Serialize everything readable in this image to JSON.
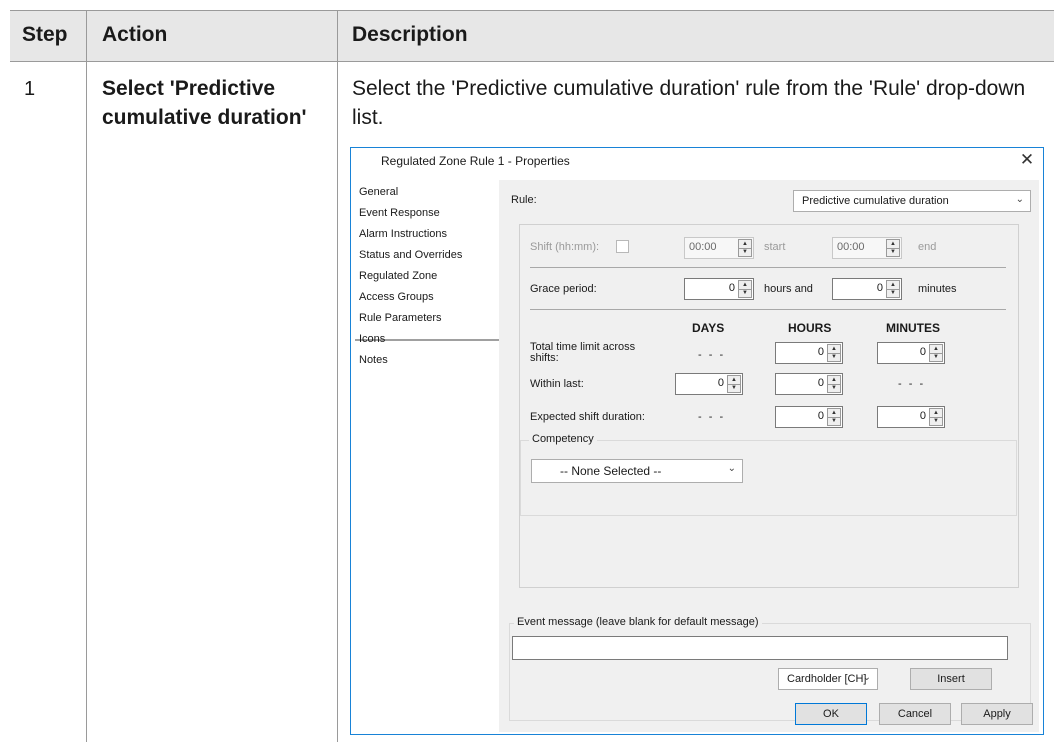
{
  "table": {
    "headers": {
      "step": "Step",
      "action": "Action",
      "description": "Description"
    },
    "row": {
      "step": "1",
      "action": "Select 'Predictive cumulative duration'",
      "description": "Select the 'Predictive cumulative duration' rule from the 'Rule' drop-down list."
    }
  },
  "dialog": {
    "title": "Regulated Zone Rule 1 - Properties",
    "close_glyph": "✕",
    "nav": {
      "items": [
        "General",
        "Event Response",
        "Alarm Instructions",
        "Status and Overrides",
        "Regulated Zone",
        "Access Groups",
        "Rule Parameters",
        "Icons",
        "Notes"
      ],
      "selected": "Rule Parameters"
    },
    "rule": {
      "label": "Rule:",
      "value": "Predictive cumulative duration"
    },
    "shift": {
      "label": "Shift (hh:mm):",
      "start_value": "00:00",
      "start_label": "start",
      "end_value": "00:00",
      "end_label": "end"
    },
    "grace": {
      "label": "Grace period:",
      "hours_value": "0",
      "hours_label": "hours and",
      "minutes_value": "0",
      "minutes_label": "minutes"
    },
    "columns": {
      "days": "DAYS",
      "hours": "HOURS",
      "minutes": "MINUTES"
    },
    "total_limit": {
      "label": "Total time limit across shifts:",
      "days": "- - -",
      "hours": "0",
      "minutes": "0"
    },
    "within_last": {
      "label": "Within last:",
      "days": "0",
      "hours": "0",
      "minutes": "- - -"
    },
    "expected_shift": {
      "label": "Expected shift duration:",
      "days": "- - -",
      "hours": "0",
      "minutes": "0"
    },
    "competency": {
      "title": "Competency",
      "value": "-- None Selected --"
    },
    "event_message": {
      "title": "Event message (leave blank for default message)",
      "value": ""
    },
    "cardholder": {
      "value": "Cardholder [CH]"
    },
    "buttons": {
      "insert": "Insert",
      "ok": "OK",
      "cancel": "Cancel",
      "apply": "Apply"
    },
    "icons": {
      "dropdown": "chevron-down-icon",
      "spin_up": "▲",
      "spin_down": "▼",
      "chevron": "⌄"
    }
  }
}
